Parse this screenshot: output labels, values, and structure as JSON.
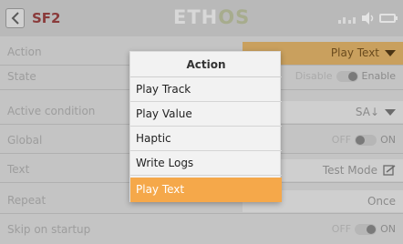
{
  "header": {
    "back_label": "<",
    "title": "SF2",
    "logo_main": "ETH",
    "logo_accent": "OS"
  },
  "rows": [
    {
      "label": "Action",
      "value": "Play Text"
    },
    {
      "label": "State",
      "off": "Disable",
      "on": "Enable"
    },
    {
      "label": "Active condition",
      "value": "SA↓"
    },
    {
      "label": "Global",
      "off": "OFF",
      "on": "ON"
    },
    {
      "label": "Text",
      "value": "Test Mode"
    },
    {
      "label": "Repeat",
      "value": "Once"
    },
    {
      "label": "Skip on startup",
      "off": "OFF",
      "on": "ON"
    }
  ],
  "popup": {
    "title": "Action",
    "items": [
      "Play Track",
      "Play Value",
      "Haptic",
      "Write Logs",
      "Play Text"
    ],
    "selected": "Play Text"
  },
  "colors": {
    "accent": "#f5a84a",
    "title": "#8a3b3b"
  }
}
